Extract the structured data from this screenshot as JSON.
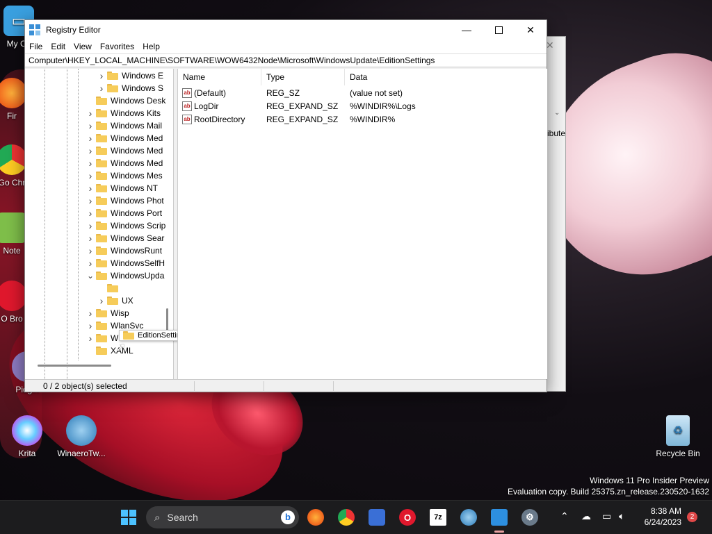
{
  "desktop": {
    "icons": [
      {
        "label": "My Co",
        "icon": "computer-icon"
      },
      {
        "label": "Fir",
        "icon": "firefox-icon"
      },
      {
        "label": "Go Chr",
        "icon": "chrome-icon"
      },
      {
        "label": "Note",
        "icon": "notepad-icon"
      },
      {
        "label": "O Bro",
        "icon": "opera-icon"
      },
      {
        "label": "Pidgin",
        "icon": "pidgin-icon"
      },
      {
        "label": "Krita",
        "icon": "krita-icon"
      },
      {
        "label": "WinaeroTw...",
        "icon": "winaero-tweaker-icon"
      },
      {
        "label": "Recycle Bin",
        "icon": "recycle-bin-icon"
      }
    ],
    "watermark": {
      "line1": "Windows 11 Pro Insider Preview",
      "line2": "Evaluation copy. Build 25375.zn_release.230520-1632"
    }
  },
  "window": {
    "title": "Registry Editor",
    "menu": [
      "File",
      "Edit",
      "View",
      "Favorites",
      "Help"
    ],
    "address": "Computer\\HKEY_LOCAL_MACHINE\\SOFTWARE\\WOW6432Node\\Microsoft\\WindowsUpdate\\EditionSettings",
    "tree": [
      {
        "label": "Windows E",
        "expand": "collapsed",
        "indent": 2
      },
      {
        "label": "Windows S",
        "expand": "collapsed",
        "indent": 2
      },
      {
        "label": "Windows Desk",
        "expand": "none",
        "indent": 1
      },
      {
        "label": "Windows Kits",
        "expand": "collapsed",
        "indent": 1
      },
      {
        "label": "Windows Mail",
        "expand": "collapsed",
        "indent": 1
      },
      {
        "label": "Windows Med",
        "expand": "collapsed",
        "indent": 1
      },
      {
        "label": "Windows Med",
        "expand": "collapsed",
        "indent": 1
      },
      {
        "label": "Windows Med",
        "expand": "collapsed",
        "indent": 1
      },
      {
        "label": "Windows Mes",
        "expand": "collapsed",
        "indent": 1
      },
      {
        "label": "Windows NT",
        "expand": "collapsed",
        "indent": 1
      },
      {
        "label": "Windows Phot",
        "expand": "collapsed",
        "indent": 1
      },
      {
        "label": "Windows Port",
        "expand": "collapsed",
        "indent": 1
      },
      {
        "label": "Windows Scrip",
        "expand": "collapsed",
        "indent": 1
      },
      {
        "label": "Windows Sear",
        "expand": "collapsed",
        "indent": 1
      },
      {
        "label": "WindowsRunt",
        "expand": "collapsed",
        "indent": 1
      },
      {
        "label": "WindowsSelfH",
        "expand": "collapsed",
        "indent": 1
      },
      {
        "label": "WindowsUpda",
        "expand": "expanded",
        "indent": 1
      },
      {
        "label": "",
        "expand": "none",
        "indent": 2
      },
      {
        "label": "UX",
        "expand": "collapsed",
        "indent": 2
      },
      {
        "label": "Wisp",
        "expand": "collapsed",
        "indent": 1
      },
      {
        "label": "WlanSvc",
        "expand": "collapsed",
        "indent": 1
      },
      {
        "label": "WSDAPI",
        "expand": "collapsed",
        "indent": 1
      },
      {
        "label": "XAML",
        "expand": "none",
        "indent": 1
      }
    ],
    "tooltip": "EditionSettings",
    "columns": {
      "name": "Name",
      "type": "Type",
      "data": "Data"
    },
    "values": [
      {
        "name": "(Default)",
        "type": "REG_SZ",
        "data": "(value not set)"
      },
      {
        "name": "LogDir",
        "type": "REG_EXPAND_SZ",
        "data": "%WINDIR%\\Logs"
      },
      {
        "name": "RootDirectory",
        "type": "REG_EXPAND_SZ",
        "data": "%WINDIR%"
      }
    ],
    "status": "0 / 2 object(s) selected",
    "bg_fragment_text": "ibute"
  },
  "taskbar": {
    "search_label": "Search",
    "apps": [
      "start-icon",
      "search-icon",
      "bing-icon",
      "firefox-icon",
      "chrome-icon",
      "krita-app-icon",
      "opera-icon",
      "7zip-icon",
      "winaero-icon",
      "regedit-icon",
      "settings-icon"
    ],
    "time": "8:38 AM",
    "date": "6/24/2023",
    "notifications": "2"
  }
}
